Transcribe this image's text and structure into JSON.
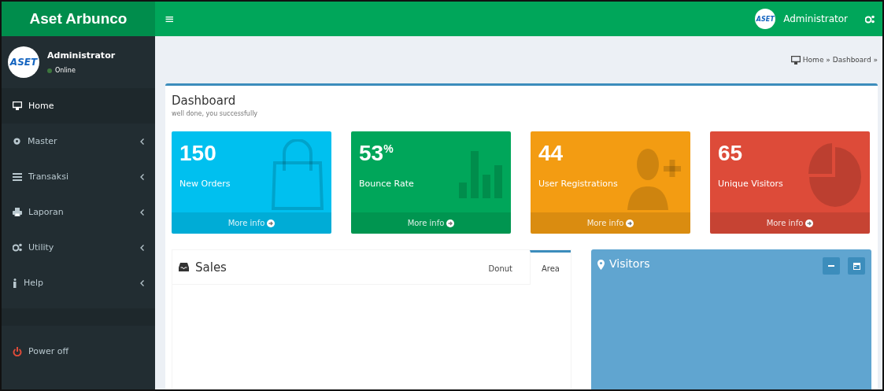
{
  "brand": "Aset Arbunco",
  "topbar": {
    "menu_toggle": "≡",
    "user": "Administrator",
    "avatar_text": "ASET"
  },
  "sidebar": {
    "user": {
      "name": "Administrator",
      "status": "Online",
      "avatar_text": "ASET"
    },
    "items": [
      {
        "label": "Home",
        "selected": true,
        "expandable": false
      },
      {
        "label": "Master",
        "selected": false,
        "expandable": true
      },
      {
        "label": "Transaksi",
        "selected": false,
        "expandable": true
      },
      {
        "label": "Laporan",
        "selected": false,
        "expandable": true
      },
      {
        "label": "Utility",
        "selected": false,
        "expandable": true
      },
      {
        "label": "Help",
        "selected": false,
        "expandable": true
      }
    ],
    "footer_item": {
      "label": "Power off"
    }
  },
  "breadcrumb": [
    "Home »",
    "Dashboard »"
  ],
  "page": {
    "title": "Dashboard",
    "subtitle": "well done, you successfully"
  },
  "stats": [
    {
      "value": "150",
      "label": "New Orders",
      "link": "More info",
      "color": "#00c0ef"
    },
    {
      "value": "53$^{%}$",
      "label": "Bounce Rate",
      "link": "More info",
      "color": "#00a65a"
    },
    {
      "value": "44",
      "label": "User Registrations",
      "link": "More info",
      "color": "#f39c12"
    },
    {
      "value": "65",
      "label": "Unique Visitors",
      "link": "More info",
      "color": "#dd4b39"
    }
  ],
  "sales": {
    "title": "Sales",
    "tabs": [
      {
        "label": "Donut",
        "selected": false
      },
      {
        "label": "Area",
        "selected": true
      }
    ]
  },
  "visitors": {
    "title": "Visitors"
  }
}
